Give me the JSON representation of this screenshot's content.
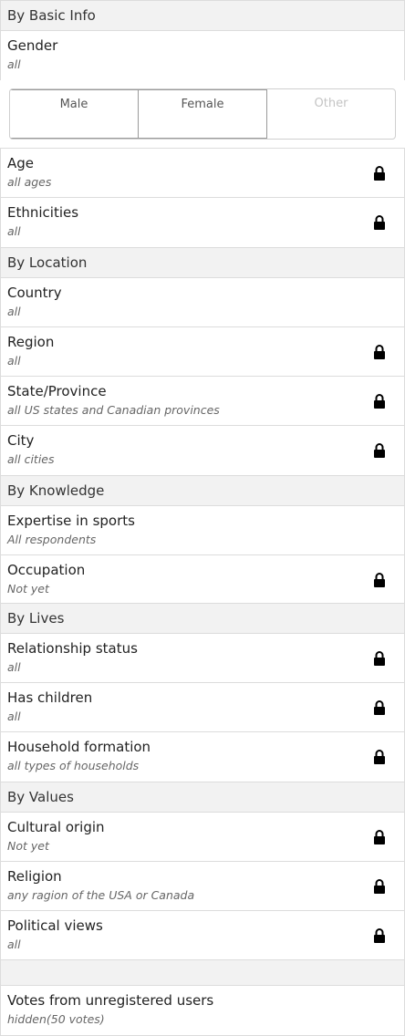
{
  "basic": {
    "header": "By Basic Info",
    "gender": {
      "label": "Gender",
      "value": "all"
    },
    "gender_options": [
      "Male",
      "Female",
      "Other"
    ],
    "rows": [
      {
        "label": "Age",
        "value": "all ages"
      },
      {
        "label": "Ethnicities",
        "value": "all"
      }
    ]
  },
  "location": {
    "header": "By Location",
    "rows": [
      {
        "label": "Country",
        "value": "all"
      },
      {
        "label": "Region",
        "value": "all"
      },
      {
        "label": "State/Province",
        "value": "all US states and Canadian provinces"
      },
      {
        "label": "City",
        "value": "all cities"
      }
    ]
  },
  "knowledge": {
    "header": "By Knowledge",
    "rows": [
      {
        "label": "Expertise in sports",
        "value": "All respondents"
      },
      {
        "label": "Occupation",
        "value": "Not yet"
      }
    ]
  },
  "lives": {
    "header": "By Lives",
    "rows": [
      {
        "label": "Relationship status",
        "value": "all"
      },
      {
        "label": "Has children",
        "value": "all"
      },
      {
        "label": "Household formation",
        "value": "all types of households"
      }
    ]
  },
  "values": {
    "header": "By Values",
    "rows": [
      {
        "label": "Cultural origin",
        "value": "Not yet"
      },
      {
        "label": "Religion",
        "value": "any ragion of the USA or Canada"
      },
      {
        "label": "Political views",
        "value": "all"
      }
    ]
  },
  "unregistered": {
    "label": "Votes from unregistered users",
    "value": "hidden(50 votes)"
  },
  "icons": {
    "lock": "lock-icon"
  }
}
